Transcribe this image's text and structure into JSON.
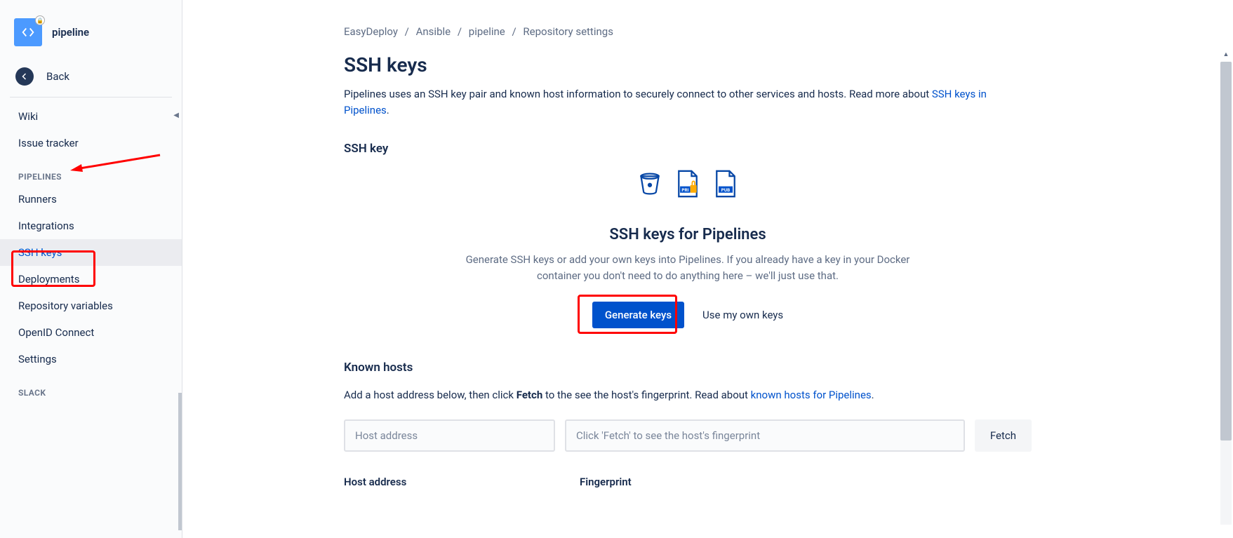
{
  "repo": {
    "name": "pipeline"
  },
  "back_label": "Back",
  "sidebar": {
    "items_top": [
      {
        "label": "Wiki"
      },
      {
        "label": "Issue tracker"
      }
    ],
    "section_pipelines": "PIPELINES",
    "items_pipelines": [
      {
        "label": "Runners"
      },
      {
        "label": "Integrations"
      },
      {
        "label": "SSH keys",
        "active": true
      },
      {
        "label": "Deployments"
      },
      {
        "label": "Repository variables"
      },
      {
        "label": "OpenID Connect"
      },
      {
        "label": "Settings"
      }
    ],
    "section_slack": "SLACK"
  },
  "breadcrumb": [
    "EasyDeploy",
    "Ansible",
    "pipeline",
    "Repository settings"
  ],
  "page": {
    "title": "SSH keys",
    "description": "Pipelines uses an SSH key pair and known host information to securely connect to other services and hosts. Read more about ",
    "description_link": "SSH keys in Pipelines",
    "description_end": ".",
    "section_ssh_key": "SSH key",
    "ssh_heading": "SSH keys for Pipelines",
    "ssh_desc": "Generate SSH keys or add your own keys into Pipelines. If you already have a key in your Docker container you don't need to do anything here – we'll just use that.",
    "generate_btn": "Generate keys",
    "use_own_btn": "Use my own keys",
    "known_hosts_title": "Known hosts",
    "known_hosts_desc_a": "Add a host address below, then click ",
    "known_hosts_desc_b": "Fetch",
    "known_hosts_desc_c": " to the see the host's fingerprint. Read about ",
    "known_hosts_link": "known hosts for Pipelines",
    "known_hosts_desc_d": ".",
    "host_placeholder": "Host address",
    "fingerprint_placeholder": "Click 'Fetch' to see the host's fingerprint",
    "fetch_btn": "Fetch",
    "col_host": "Host address",
    "col_fp": "Fingerprint"
  },
  "doc_labels": {
    "pri": "PRI",
    "pub": "PUB"
  }
}
